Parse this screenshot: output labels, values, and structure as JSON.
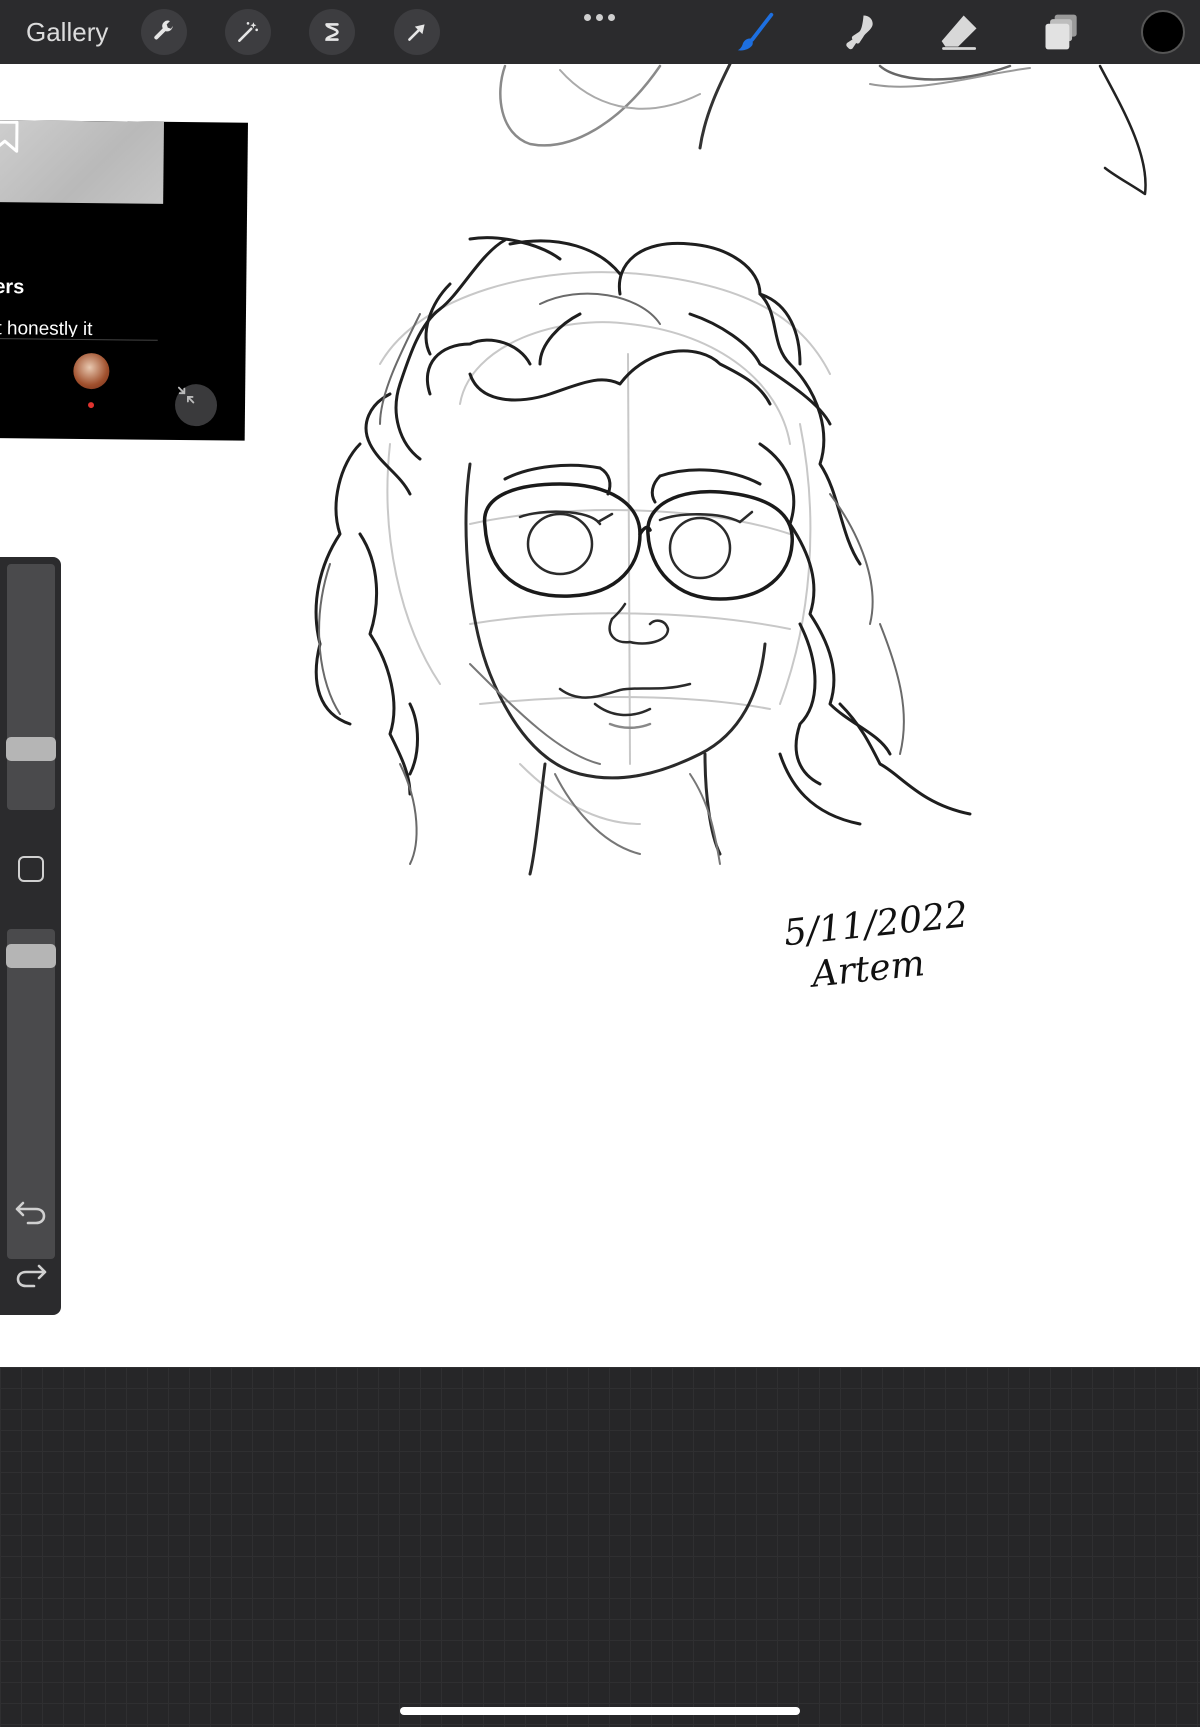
{
  "toolbar": {
    "gallery_label": "Gallery",
    "left_tools": [
      "wrench-icon",
      "magic-wand-icon",
      "selection-icon",
      "transform-arrow-icon"
    ],
    "right_tools": [
      "brush-icon",
      "smudge-icon",
      "eraser-icon",
      "layers-icon"
    ],
    "active_tool": "brush",
    "active_color": "#1d6fe0",
    "current_color": "#000000"
  },
  "canvas": {
    "signature_date": "5/11/2022",
    "signature_name": "Artem"
  },
  "pip": {
    "text_line1": "ers",
    "text_line2": "ut honestly it"
  },
  "sidebar": {
    "brush_size_fraction": 0.22,
    "opacity_fraction": 0.95
  },
  "colors": {
    "toolbar_bg": "#2b2b2d",
    "canvas_bg": "#ffffff",
    "bottom_bg": "#262628"
  }
}
